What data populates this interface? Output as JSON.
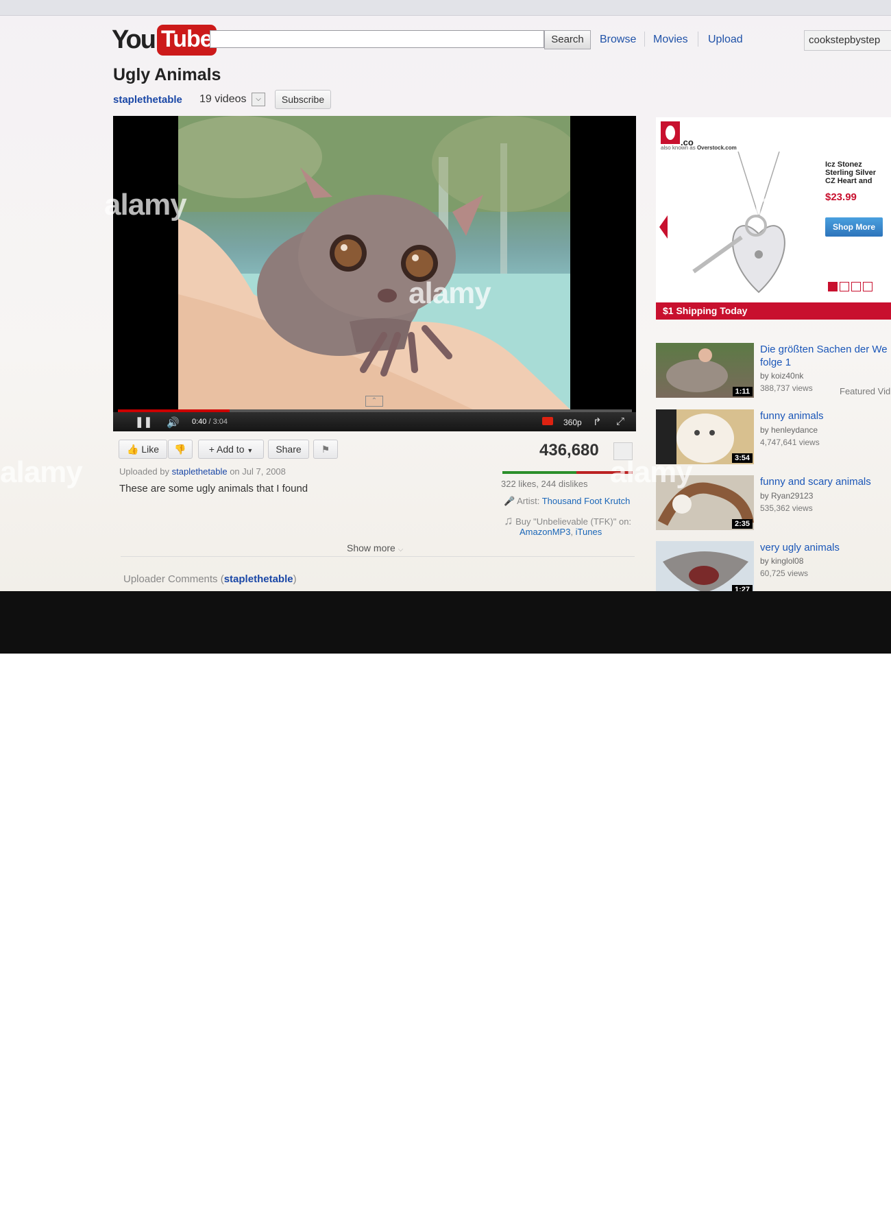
{
  "header": {
    "logo_you": "You",
    "logo_tube": "Tube",
    "search_button": "Search",
    "nav": [
      "Browse",
      "Movies",
      "Upload"
    ],
    "username": "cookstepbystep"
  },
  "video": {
    "title": "Ugly Animals",
    "channel": "staplethetable",
    "video_count": "19 videos",
    "subscribe": "Subscribe",
    "time_current": "0:40",
    "time_total": "/ 3:04",
    "quality": "360p",
    "progress_fraction": 0.2174
  },
  "actions": {
    "like": "Like",
    "add_to": "Add to",
    "share": "Share",
    "views": "436,680",
    "likes_dislikes": "322 likes, 244 dislikes",
    "like_fraction": 0.569
  },
  "info": {
    "uploaded_prefix": "Uploaded by",
    "uploader": "staplethetable",
    "uploaded_on": "on Jul 7, 2008",
    "description": "These are some ugly animals that I found",
    "artist_label": "Artist:",
    "artist": "Thousand Foot Krutch",
    "buy_text": "Buy \"Unbelievable (TFK)\" on:",
    "store1": "AmazonMP3",
    "store2": "iTunes",
    "show_more": "Show more",
    "uploader_comments_label": "Uploader Comments (",
    "uploader_comments_user": "staplethetable",
    "uploader_comments_close": ")"
  },
  "ad": {
    "brand": ".co",
    "aka": "also known as",
    "aka_brand": "Overstock.com",
    "product": "Icz Stonez Sterling Silver CZ Heart and",
    "price": "$23.99",
    "cta": "Shop More",
    "banner": "$1 Shipping Today",
    "accent": "#c8102e"
  },
  "related": [
    {
      "title": "Die größten Sachen der We folge 1",
      "by": "by koiz40nk",
      "views": "388,737 views",
      "duration": "1:11"
    },
    {
      "title": "funny animals",
      "by": "by henleydance",
      "views": "4,747,641 views",
      "duration": "3:54"
    },
    {
      "title": "funny and scary animals",
      "by": "by Ryan29123",
      "views": "535,362 views",
      "duration": "2:35"
    },
    {
      "title": "very ugly animals",
      "by": "by kinglol08",
      "views": "60,725 views",
      "duration": "1:27"
    }
  ],
  "featured_label": "Featured Vid",
  "watermark": {
    "text": "alamy",
    "image_id": "C8WKBG",
    "site": "www.alamy.com"
  }
}
